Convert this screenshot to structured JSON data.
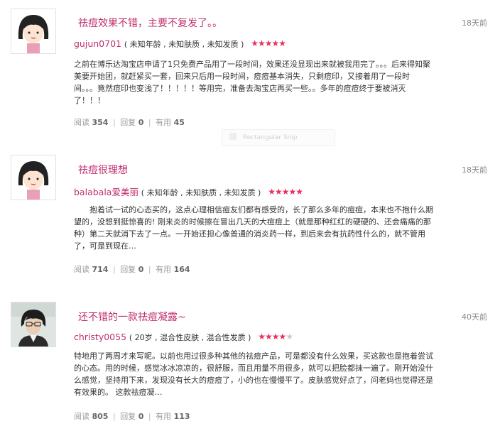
{
  "reviews": [
    {
      "title": "祛痘效果不错，主要不复发了。。",
      "age": "18天前",
      "user": "gujun0701",
      "attrs": "( 未知年龄 , 未知肤质 , 未知发质 )",
      "rating": 5,
      "text_lines": [
        "之前在博乐达淘宝店申请了1只免费产品用了一段时间，效果还没显现出来就被我用完了。。。后来得知聚",
        "美要开始团，就赶紧买一套，回来只后用一段时间，痘痘基本消失，只剩痘印，又接着用了一段时",
        "间。。。竟然痘印也变浅了！！！！！等用完，准备去淘宝店再买一些。。多年的痘痘终于要被消灭",
        "了！！！"
      ],
      "stats": {
        "read_label": "阅读",
        "read": "354",
        "reply_label": "回复",
        "reply": "0",
        "useful_label": "有用",
        "useful": "45"
      }
    },
    {
      "title": "祛痘很理想",
      "age": "18天前",
      "user": "balabala爱美丽",
      "attrs": "( 未知年龄 , 未知肤质 , 未知发质 )",
      "rating": 5,
      "text_lines": [
        "　　抱着试一试的心态买的，这点心理相信痘友们都有感受的，长了那么多年的痘痘，本来也不抱什么期",
        "望的，没想到挺惊喜的! 刚来炎的时候擦在冒出几天的大痘痘上（就是那种红红的硬硬的、还会痛痛的那",
        "种）第二天就消下去了一点。一开始还担心像普通的消炎药一样，到后来会有抗药性什么的，就不管用",
        "了，可是到现在…"
      ],
      "stats": {
        "read_label": "阅读",
        "read": "714",
        "reply_label": "回复",
        "reply": "0",
        "useful_label": "有用",
        "useful": "164"
      }
    },
    {
      "title": "还不错的一款祛痘凝露~",
      "age": "40天前",
      "user": "christy0055",
      "attrs": "( 20岁 , 混合性皮肤 , 混合性发质 )",
      "rating": 4,
      "text_lines": [
        "特地用了两周才来写呢。以前也用过很多种其他的祛痘产品，可是都没有什么效果，买这款也是抱着尝试",
        "的心态。用的时候，感觉冰冰凉凉的，很舒服，而且用量不用很多，就可以把脸都抹一遍了。刚开始没什",
        "么感觉，坚持用下来，发现没有长大的痘痘了，小的也在慢慢平了。皮肤感觉好点了，问老妈也觉得还是",
        "有效果的。 这款祛痘凝…"
      ],
      "stats": {
        "read_label": "阅读",
        "read": "805",
        "reply_label": "回复",
        "reply": "0",
        "useful_label": "有用",
        "useful": "113"
      }
    }
  ],
  "snip_overlay": {
    "label": "Rectangular Snip"
  },
  "colors": {
    "accent": "#c0306f",
    "star": "#e8305f"
  }
}
